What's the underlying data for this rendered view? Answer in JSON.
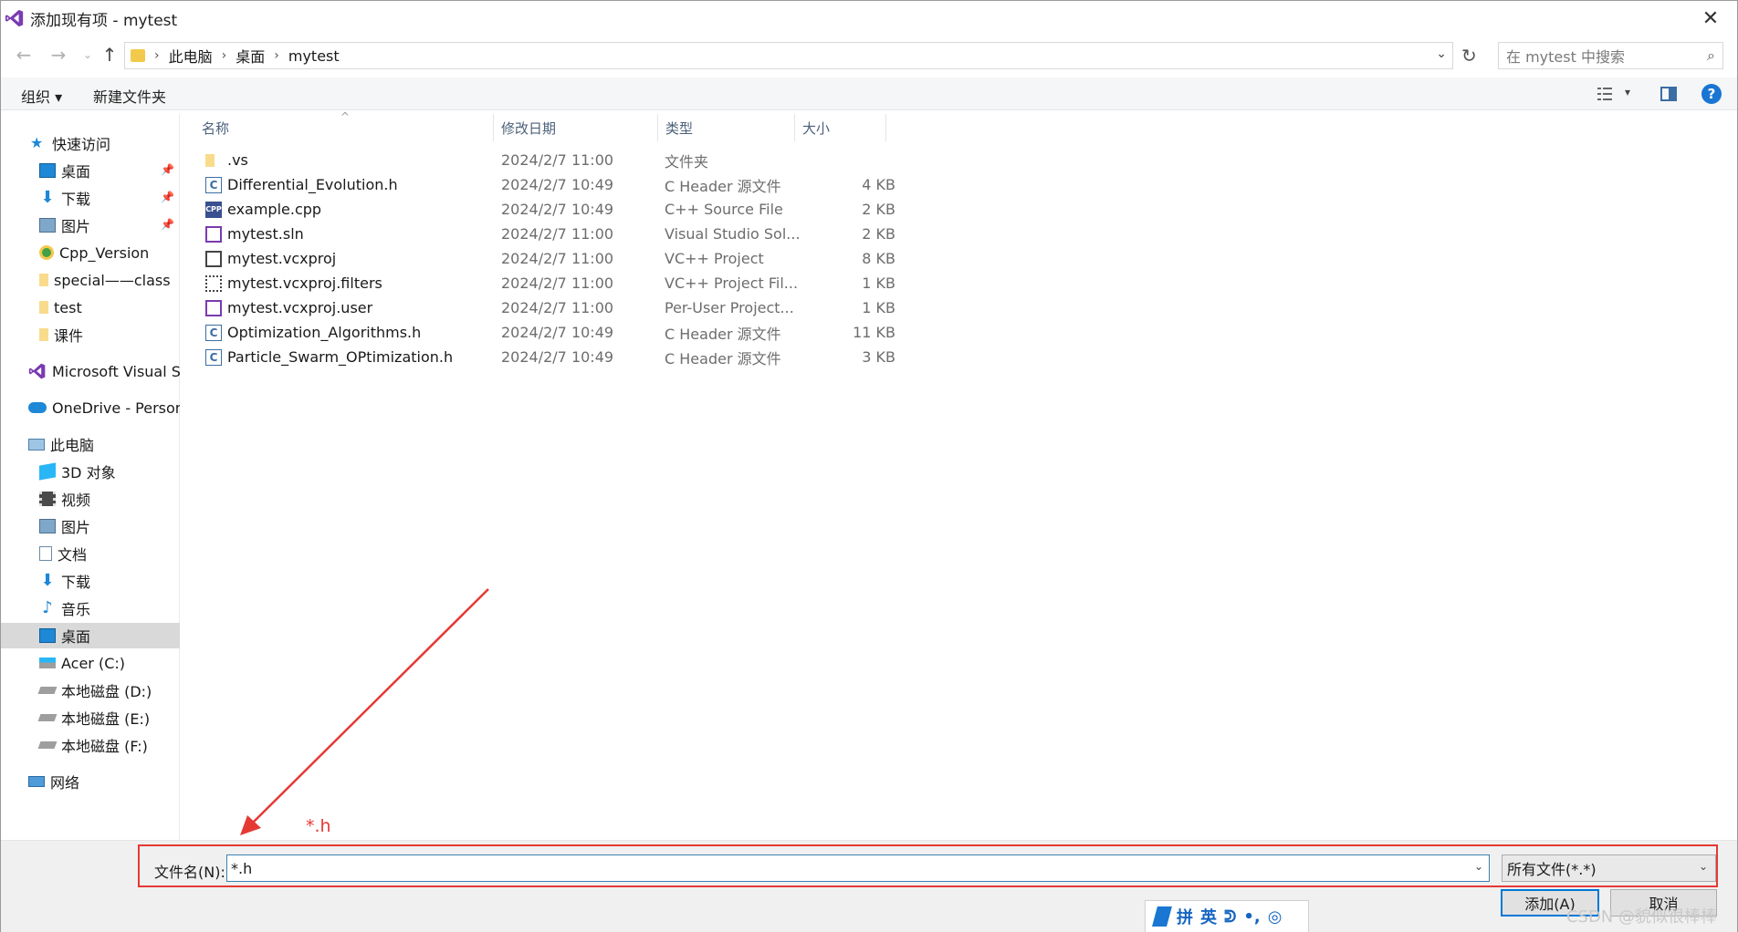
{
  "window": {
    "title": "添加现有项 - mytest",
    "close_glyph": "✕"
  },
  "address": {
    "crumbs": [
      "此电脑",
      "桌面",
      "mytest"
    ],
    "search_placeholder": "在 mytest 中搜索"
  },
  "toolbar": {
    "organize": "组织 ▾",
    "new_folder": "新建文件夹",
    "help": "?"
  },
  "sidebar": {
    "items": [
      {
        "label": "快速访问",
        "icon": "star-icon",
        "color": "#1e88d6"
      },
      {
        "label": "桌面",
        "icon": "desktop-icon",
        "pinned": true
      },
      {
        "label": "下载",
        "icon": "download-icon",
        "pinned": true
      },
      {
        "label": "图片",
        "icon": "pictures-icon",
        "pinned": true
      },
      {
        "label": "Cpp_Version",
        "icon": "sync-folder-icon"
      },
      {
        "label": "special——class",
        "icon": "folder-icon"
      },
      {
        "label": "test",
        "icon": "folder-icon"
      },
      {
        "label": "课件",
        "icon": "folder-icon"
      },
      {
        "label": "Microsoft Visual Stu",
        "icon": "visual-studio-icon"
      },
      {
        "label": "OneDrive - Persona",
        "icon": "cloud-icon"
      },
      {
        "label": "此电脑",
        "icon": "computer-icon"
      },
      {
        "label": "3D 对象",
        "icon": "3d-objects-icon"
      },
      {
        "label": "视频",
        "icon": "video-icon"
      },
      {
        "label": "图片",
        "icon": "pictures-icon"
      },
      {
        "label": "文档",
        "icon": "documents-icon"
      },
      {
        "label": "下载",
        "icon": "download-icon"
      },
      {
        "label": "音乐",
        "icon": "music-icon"
      },
      {
        "label": "桌面",
        "icon": "desktop-icon",
        "selected": true
      },
      {
        "label": "Acer (C:)",
        "icon": "drive-c-icon"
      },
      {
        "label": "本地磁盘 (D:)",
        "icon": "drive-icon"
      },
      {
        "label": "本地磁盘 (E:)",
        "icon": "drive-icon"
      },
      {
        "label": "本地磁盘 (F:)",
        "icon": "drive-icon"
      },
      {
        "label": "网络",
        "icon": "network-icon"
      }
    ]
  },
  "columns": {
    "name": "名称",
    "date": "修改日期",
    "type": "类型",
    "size": "大小"
  },
  "files": [
    {
      "name": ".vs",
      "date": "2024/2/7 11:00",
      "type": "文件夹",
      "size": "",
      "icon": "folder-icon"
    },
    {
      "name": "Differential_Evolution.h",
      "date": "2024/2/7 10:49",
      "type": "C Header 源文件",
      "size": "4 KB",
      "icon": "header-file-icon"
    },
    {
      "name": "example.cpp",
      "date": "2024/2/7 10:49",
      "type": "C++ Source File",
      "size": "2 KB",
      "icon": "cpp-file-icon"
    },
    {
      "name": "mytest.sln",
      "date": "2024/2/7 11:00",
      "type": "Visual Studio Sol...",
      "size": "2 KB",
      "icon": "solution-file-icon"
    },
    {
      "name": "mytest.vcxproj",
      "date": "2024/2/7 11:00",
      "type": "VC++ Project",
      "size": "8 KB",
      "icon": "project-file-icon"
    },
    {
      "name": "mytest.vcxproj.filters",
      "date": "2024/2/7 11:00",
      "type": "VC++ Project Fil...",
      "size": "1 KB",
      "icon": "filters-file-icon"
    },
    {
      "name": "mytest.vcxproj.user",
      "date": "2024/2/7 11:00",
      "type": "Per-User Project...",
      "size": "1 KB",
      "icon": "user-file-icon"
    },
    {
      "name": "Optimization_Algorithms.h",
      "date": "2024/2/7 10:49",
      "type": "C Header 源文件",
      "size": "11 KB",
      "icon": "header-file-icon"
    },
    {
      "name": "Particle_Swarm_OPtimization.h",
      "date": "2024/2/7 10:49",
      "type": "C Header 源文件",
      "size": "3 KB",
      "icon": "header-file-icon"
    }
  ],
  "footer": {
    "filename_label": "文件名(N):",
    "filename_value": "*.h",
    "filter_value": "所有文件(*.*)",
    "add_button": "添加(A)",
    "cancel_button": "取消"
  },
  "annotation": {
    "text": "*.h",
    "color": "#e53935"
  },
  "ime": {
    "chars": [
      "拼",
      "英",
      "ᕲ",
      "•,",
      "◎"
    ]
  },
  "watermark": "CSDN @貌似很棒棒"
}
